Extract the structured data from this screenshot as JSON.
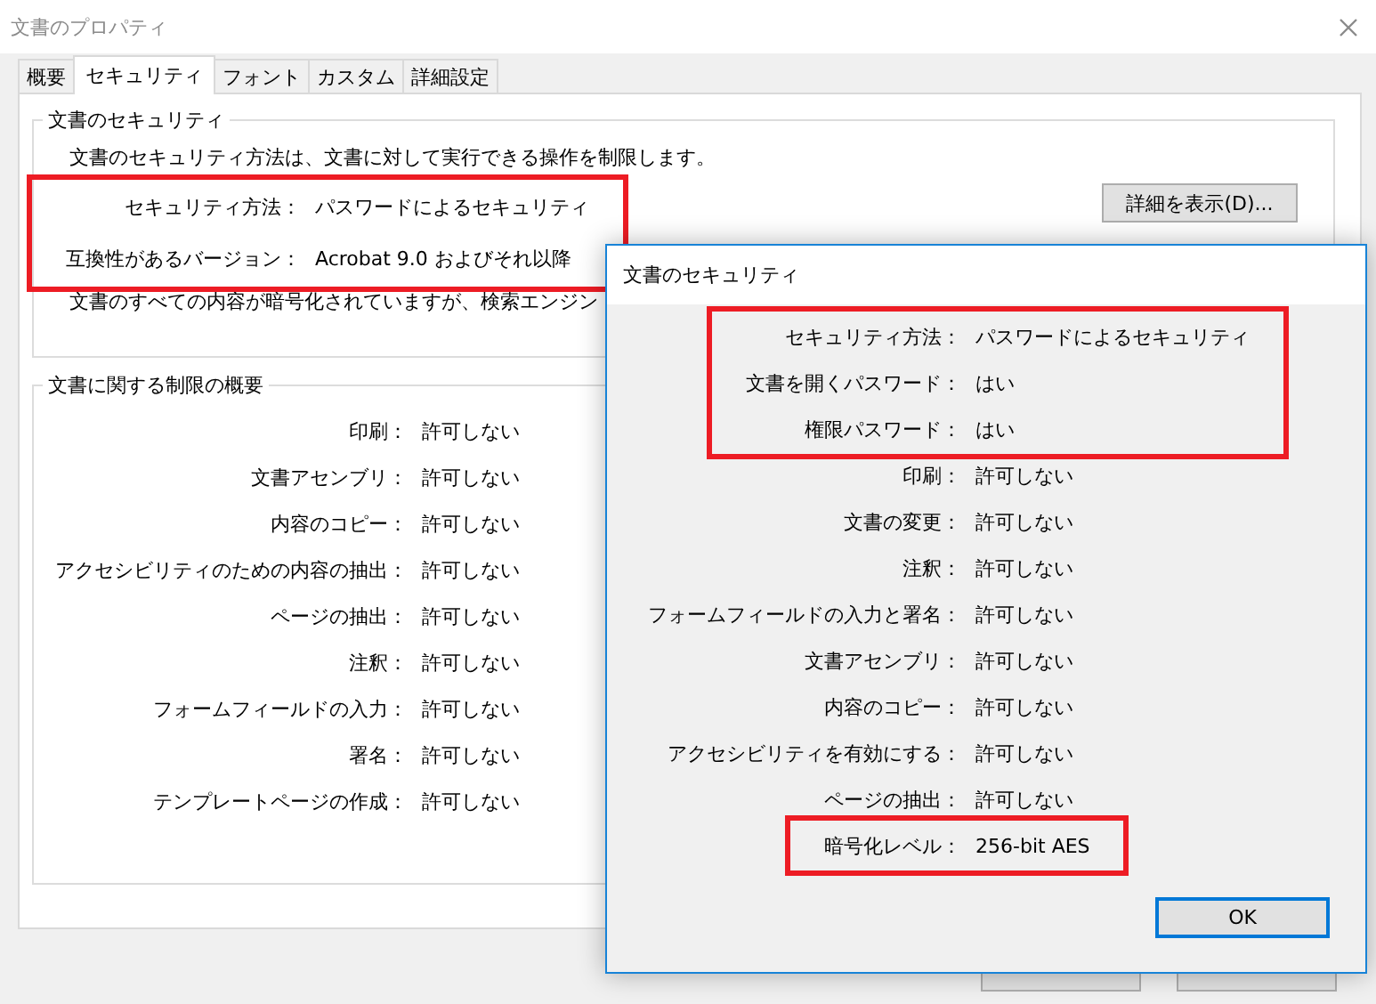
{
  "window": {
    "title": "文書のプロパティ"
  },
  "tabs": [
    {
      "label": "概要",
      "selected": false
    },
    {
      "label": "セキュリティ",
      "selected": true
    },
    {
      "label": "フォント",
      "selected": false
    },
    {
      "label": "カスタム",
      "selected": false
    },
    {
      "label": "詳細設定",
      "selected": false
    }
  ],
  "document_security": {
    "title": "文書のセキュリティ",
    "description": "文書のセキュリティ方法は、文書に対して実行できる操作を制限します。",
    "blocks": [
      {
        "highlighted": true,
        "rows": [
          {
            "label": "セキュリティ方法：",
            "value": "パスワードによるセキュリティ"
          },
          {
            "label": "互換性があるバージョン：",
            "value": "Acrobat 9.0 およびそれ以降"
          }
        ]
      }
    ],
    "details_button": "詳細を表示(D)...",
    "note": "文書のすべての内容が暗号化されていますが、検索エンジン"
  },
  "restrictions": {
    "title": "文書に関する制限の概要",
    "blocks": [
      {
        "highlighted": false,
        "rows": [
          {
            "label": "印刷：",
            "value": "許可しない"
          },
          {
            "label": "文書アセンブリ：",
            "value": "許可しない"
          },
          {
            "label": "内容のコピー：",
            "value": "許可しない"
          },
          {
            "label": "アクセシビリティのための内容の抽出：",
            "value": "許可しない"
          },
          {
            "label": "ページの抽出：",
            "value": "許可しない"
          },
          {
            "label": "注釈：",
            "value": "許可しない"
          },
          {
            "label": "フォームフィールドの入力：",
            "value": "許可しない"
          },
          {
            "label": "署名：",
            "value": "許可しない"
          },
          {
            "label": "テンプレートページの作成：",
            "value": "許可しない"
          }
        ]
      }
    ]
  },
  "security_dialog": {
    "title": "文書のセキュリティ",
    "blocks": [
      {
        "highlighted": true,
        "rows": [
          {
            "label": "セキュリティ方法：",
            "value": "パスワードによるセキュリティ"
          },
          {
            "label": "文書を開くパスワード：",
            "value": "はい"
          },
          {
            "label": "権限パスワード：",
            "value": "はい"
          }
        ]
      },
      {
        "highlighted": false,
        "rows": [
          {
            "label": "印刷：",
            "value": "許可しない"
          },
          {
            "label": "文書の変更：",
            "value": "許可しない"
          },
          {
            "label": "注釈：",
            "value": "許可しない"
          },
          {
            "label": "フォームフィールドの入力と署名：",
            "value": "許可しない"
          },
          {
            "label": "文書アセンブリ：",
            "value": "許可しない"
          },
          {
            "label": "内容のコピー：",
            "value": "許可しない"
          },
          {
            "label": "アクセシビリティを有効にする：",
            "value": "許可しない"
          },
          {
            "label": "ページの抽出：",
            "value": "許可しない"
          }
        ]
      },
      {
        "highlighted": true,
        "rows": [
          {
            "label": "暗号化レベル：",
            "value": "256-bit AES"
          }
        ]
      }
    ],
    "ok_button": "OK"
  }
}
